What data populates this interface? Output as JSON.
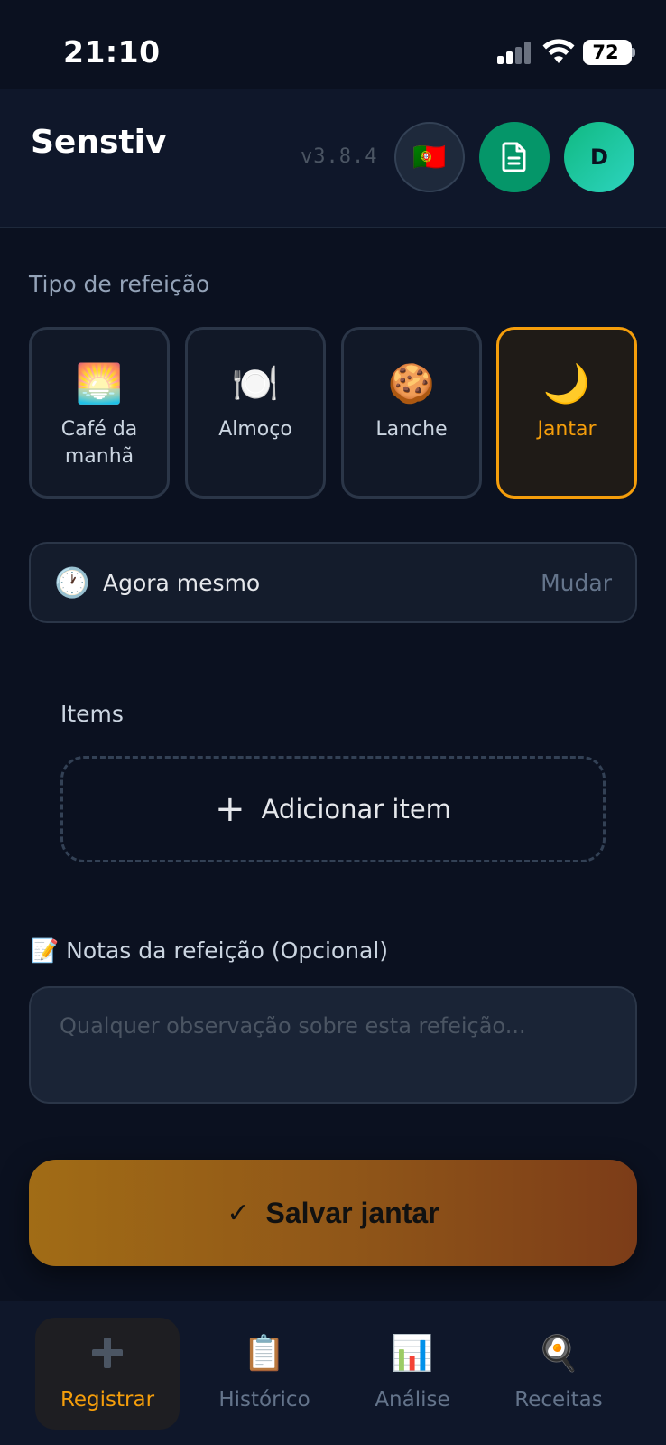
{
  "status_bar": {
    "time": "21:10",
    "battery": "72"
  },
  "header": {
    "app_name": "Senstiv",
    "version": "v3.8.4",
    "flag_emoji": "🇵🇹",
    "avatar_initial": "D"
  },
  "meal_type": {
    "label": "Tipo de refeição",
    "options": [
      {
        "emoji": "🌅",
        "label": "Café da manhã",
        "selected": false
      },
      {
        "emoji": "🍽️",
        "label": "Almoço",
        "selected": false
      },
      {
        "emoji": "🍪",
        "label": "Lanche",
        "selected": false
      },
      {
        "emoji": "🌙",
        "label": "Jantar",
        "selected": true
      }
    ]
  },
  "time": {
    "icon": "🕐",
    "value": "Agora mesmo",
    "change_label": "Mudar"
  },
  "items": {
    "label": "Items",
    "add_label": "Adicionar item"
  },
  "notes": {
    "icon": "📝",
    "label": "Notas da refeição (Opcional)",
    "placeholder": "Qualquer observação sobre esta refeição..."
  },
  "save": {
    "label": "Salvar jantar"
  },
  "nav": {
    "items": [
      {
        "label": "Registrar",
        "icon": "plus-icon",
        "active": true
      },
      {
        "label": "Histórico",
        "icon": "📋",
        "active": false
      },
      {
        "label": "Análise",
        "icon": "📊",
        "active": false
      },
      {
        "label": "Receitas",
        "icon": "🍳",
        "active": false
      }
    ]
  },
  "colors": {
    "background": "#0b1120",
    "accent": "#f59e0b",
    "brand_green": "#059669"
  }
}
